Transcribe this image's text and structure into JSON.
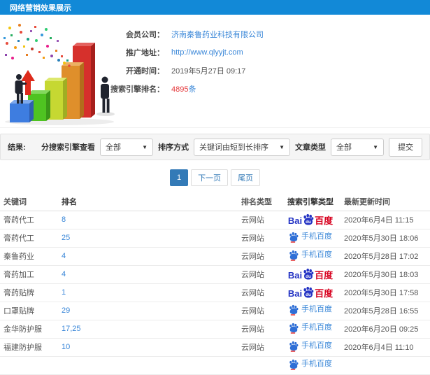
{
  "header": {
    "title": "网络营销效果展示"
  },
  "info": {
    "rows": [
      {
        "label": "会员公司：",
        "value": "济南秦鲁药业科技有限公司"
      },
      {
        "label": "推广地址：",
        "value": "http://www.qlyyjt.com"
      },
      {
        "label": "开通时间：",
        "value": "2019年5月27日 09:17"
      },
      {
        "label": "搜索引擎排名：",
        "value": "4895",
        "suffix": "条"
      }
    ]
  },
  "filters": {
    "result_label": "结果:",
    "engine_label": "分搜索引擎查看",
    "engine_value": "全部",
    "sort_label": "排序方式",
    "sort_value": "关键词由短到长排序",
    "article_label": "文章类型",
    "article_value": "全部",
    "submit_label": "提交",
    "caret": "▼"
  },
  "pagination": {
    "current": "1",
    "next": "下一页",
    "last": "尾页"
  },
  "engines": {
    "baidu_logo": {
      "bai": "Bai",
      "du": "du",
      "suffix": "百度"
    },
    "mobile_logo": {
      "label": "手机百度"
    }
  },
  "table": {
    "headers": [
      "关键词",
      "排名",
      "排名类型",
      "搜索引擎类型",
      "最新更新时间"
    ],
    "rows": [
      {
        "keyword": "膏药代工",
        "rank": "8",
        "rank_type": "云网站",
        "engine": "baidu",
        "updated": "2020年6月4日 11:15"
      },
      {
        "keyword": "膏药代工",
        "rank": "25",
        "rank_type": "云网站",
        "engine": "mobile",
        "updated": "2020年5月30日 18:06"
      },
      {
        "keyword": "秦鲁药业",
        "rank": "4",
        "rank_type": "云网站",
        "engine": "mobile",
        "updated": "2020年5月28日 17:02"
      },
      {
        "keyword": "膏药加工",
        "rank": "4",
        "rank_type": "云网站",
        "engine": "baidu",
        "updated": "2020年5月30日 18:03"
      },
      {
        "keyword": "膏药贴牌",
        "rank": "1",
        "rank_type": "云网站",
        "engine": "baidu",
        "updated": "2020年5月30日 17:58"
      },
      {
        "keyword": "口罩贴牌",
        "rank": "29",
        "rank_type": "云网站",
        "engine": "mobile",
        "updated": "2020年5月28日 16:55"
      },
      {
        "keyword": "金华防护服",
        "rank": "17,25",
        "rank_type": "云网站",
        "engine": "mobile",
        "updated": "2020年6月20日 09:25"
      },
      {
        "keyword": "福建防护服",
        "rank": "10",
        "rank_type": "云网站",
        "engine": "mobile",
        "updated": "2020年6月4日 11:10"
      },
      {
        "keyword": "",
        "rank": "",
        "rank_type": "",
        "engine": "mobile",
        "updated": ""
      }
    ]
  },
  "colors": {
    "topbar_blue": "#1289d7",
    "link_blue": "#3a87d8",
    "highlight_red": "#e4393c",
    "baidu_blue": "#2534c4",
    "baidu_red": "#d7001e",
    "pagination_active": "#337ab7"
  }
}
